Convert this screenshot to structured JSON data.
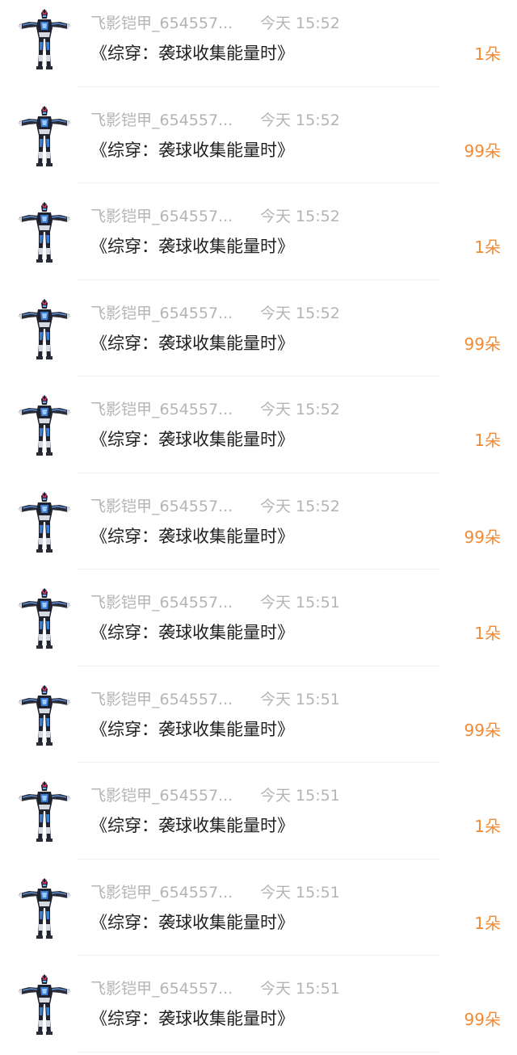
{
  "colors": {
    "name": "#b4b4b4",
    "time": "#b4b4b4",
    "title": "#1e1e1e",
    "amount": "#f28a33"
  },
  "avatar_icon": "armored-hero-icon",
  "items": [
    {
      "name": "飞影铠甲_654557...",
      "time": "今天 15:52",
      "title": "《综穿：袭球收集能量时》",
      "amount": "1朵"
    },
    {
      "name": "飞影铠甲_654557...",
      "time": "今天 15:52",
      "title": "《综穿：袭球收集能量时》",
      "amount": "99朵"
    },
    {
      "name": "飞影铠甲_654557...",
      "time": "今天 15:52",
      "title": "《综穿：袭球收集能量时》",
      "amount": "1朵"
    },
    {
      "name": "飞影铠甲_654557...",
      "time": "今天 15:52",
      "title": "《综穿：袭球收集能量时》",
      "amount": "99朵"
    },
    {
      "name": "飞影铠甲_654557...",
      "time": "今天 15:52",
      "title": "《综穿：袭球收集能量时》",
      "amount": "1朵"
    },
    {
      "name": "飞影铠甲_654557...",
      "time": "今天 15:52",
      "title": "《综穿：袭球收集能量时》",
      "amount": "99朵"
    },
    {
      "name": "飞影铠甲_654557...",
      "time": "今天 15:51",
      "title": "《综穿：袭球收集能量时》",
      "amount": "1朵"
    },
    {
      "name": "飞影铠甲_654557...",
      "time": "今天 15:51",
      "title": "《综穿：袭球收集能量时》",
      "amount": "99朵"
    },
    {
      "name": "飞影铠甲_654557...",
      "time": "今天 15:51",
      "title": "《综穿：袭球收集能量时》",
      "amount": "1朵"
    },
    {
      "name": "飞影铠甲_654557...",
      "time": "今天 15:51",
      "title": "《综穿：袭球收集能量时》",
      "amount": "1朵"
    },
    {
      "name": "飞影铠甲_654557...",
      "time": "今天 15:51",
      "title": "《综穿：袭球收集能量时》",
      "amount": "99朵"
    }
  ]
}
